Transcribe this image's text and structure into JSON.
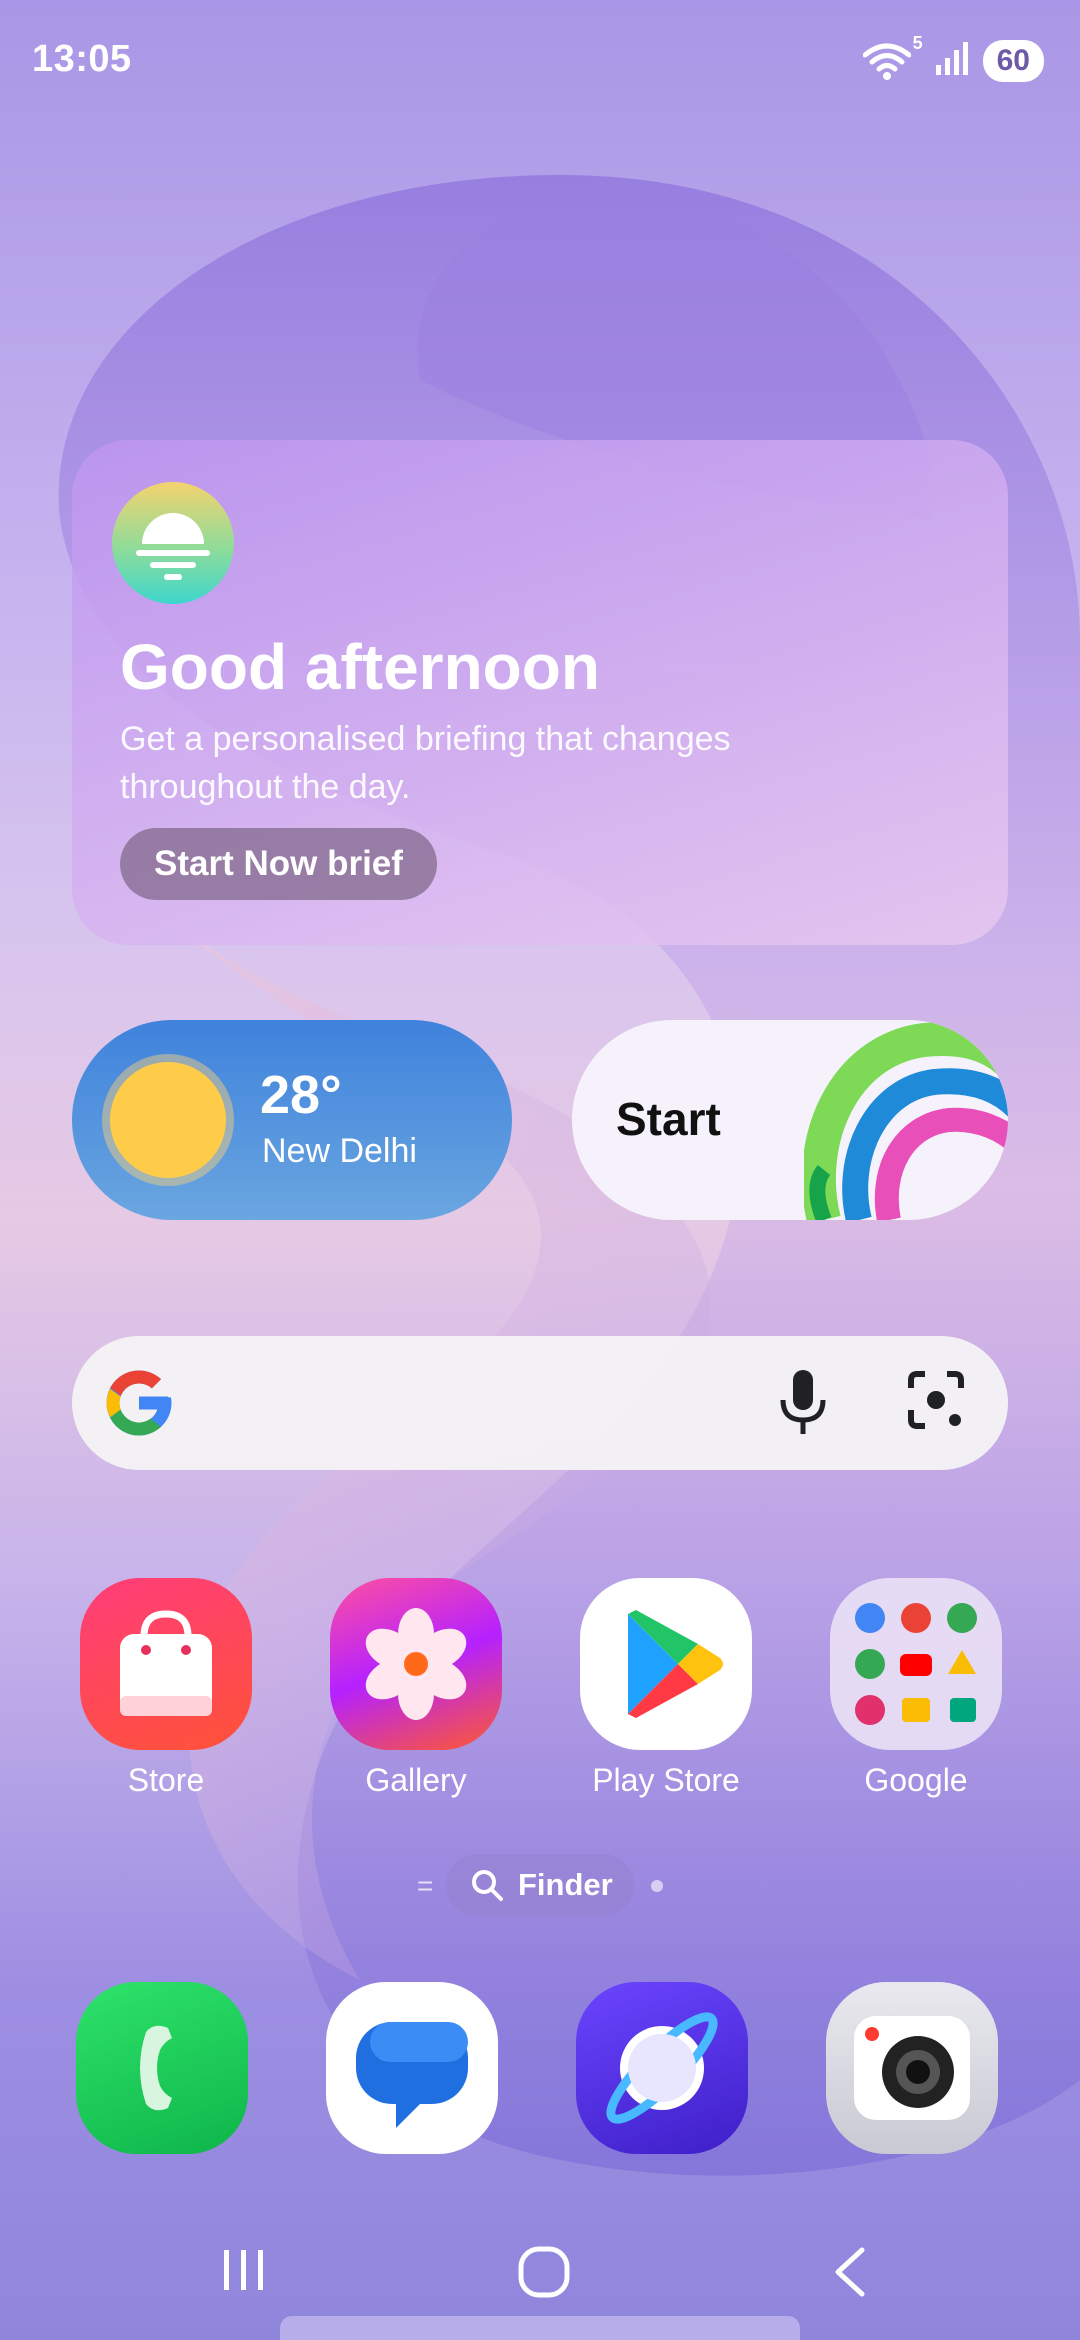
{
  "status_bar": {
    "time": "13:05",
    "wifi_label": "5",
    "battery": "60"
  },
  "briefing_card": {
    "title": "Good afternoon",
    "subtitle": "Get a personalised briefing that changes throughout the day.",
    "button_label": "Start Now brief",
    "icon": "sunset-icon"
  },
  "weather_widget": {
    "temperature": "28°",
    "city": "New Delhi",
    "icon": "sun-icon"
  },
  "start_widget": {
    "label": "Start",
    "icon": "heart-rainbow-icon"
  },
  "search_bar": {
    "icons": [
      "google-g-icon",
      "microphone-icon",
      "camera-lens-icon"
    ]
  },
  "apps": [
    {
      "label": "Store",
      "icon": "shopping-bag-icon"
    },
    {
      "label": "Gallery",
      "icon": "flower-icon"
    },
    {
      "label": "Play Store",
      "icon": "play-triangle-icon"
    },
    {
      "label": "Google",
      "icon": "google-folder-icon"
    }
  ],
  "finder": {
    "label": "Finder"
  },
  "dock": [
    {
      "name": "Phone",
      "icon": "phone-icon"
    },
    {
      "name": "Messages",
      "icon": "chat-bubble-icon"
    },
    {
      "name": "Internet",
      "icon": "planet-icon"
    },
    {
      "name": "Camera",
      "icon": "camera-icon"
    }
  ],
  "nav_bar": [
    "recents-icon",
    "home-icon",
    "back-icon"
  ],
  "colors": {
    "weather_bg": "#3f82dc",
    "search_bg": "#f5f2f6",
    "accent": "#8f86dc"
  }
}
